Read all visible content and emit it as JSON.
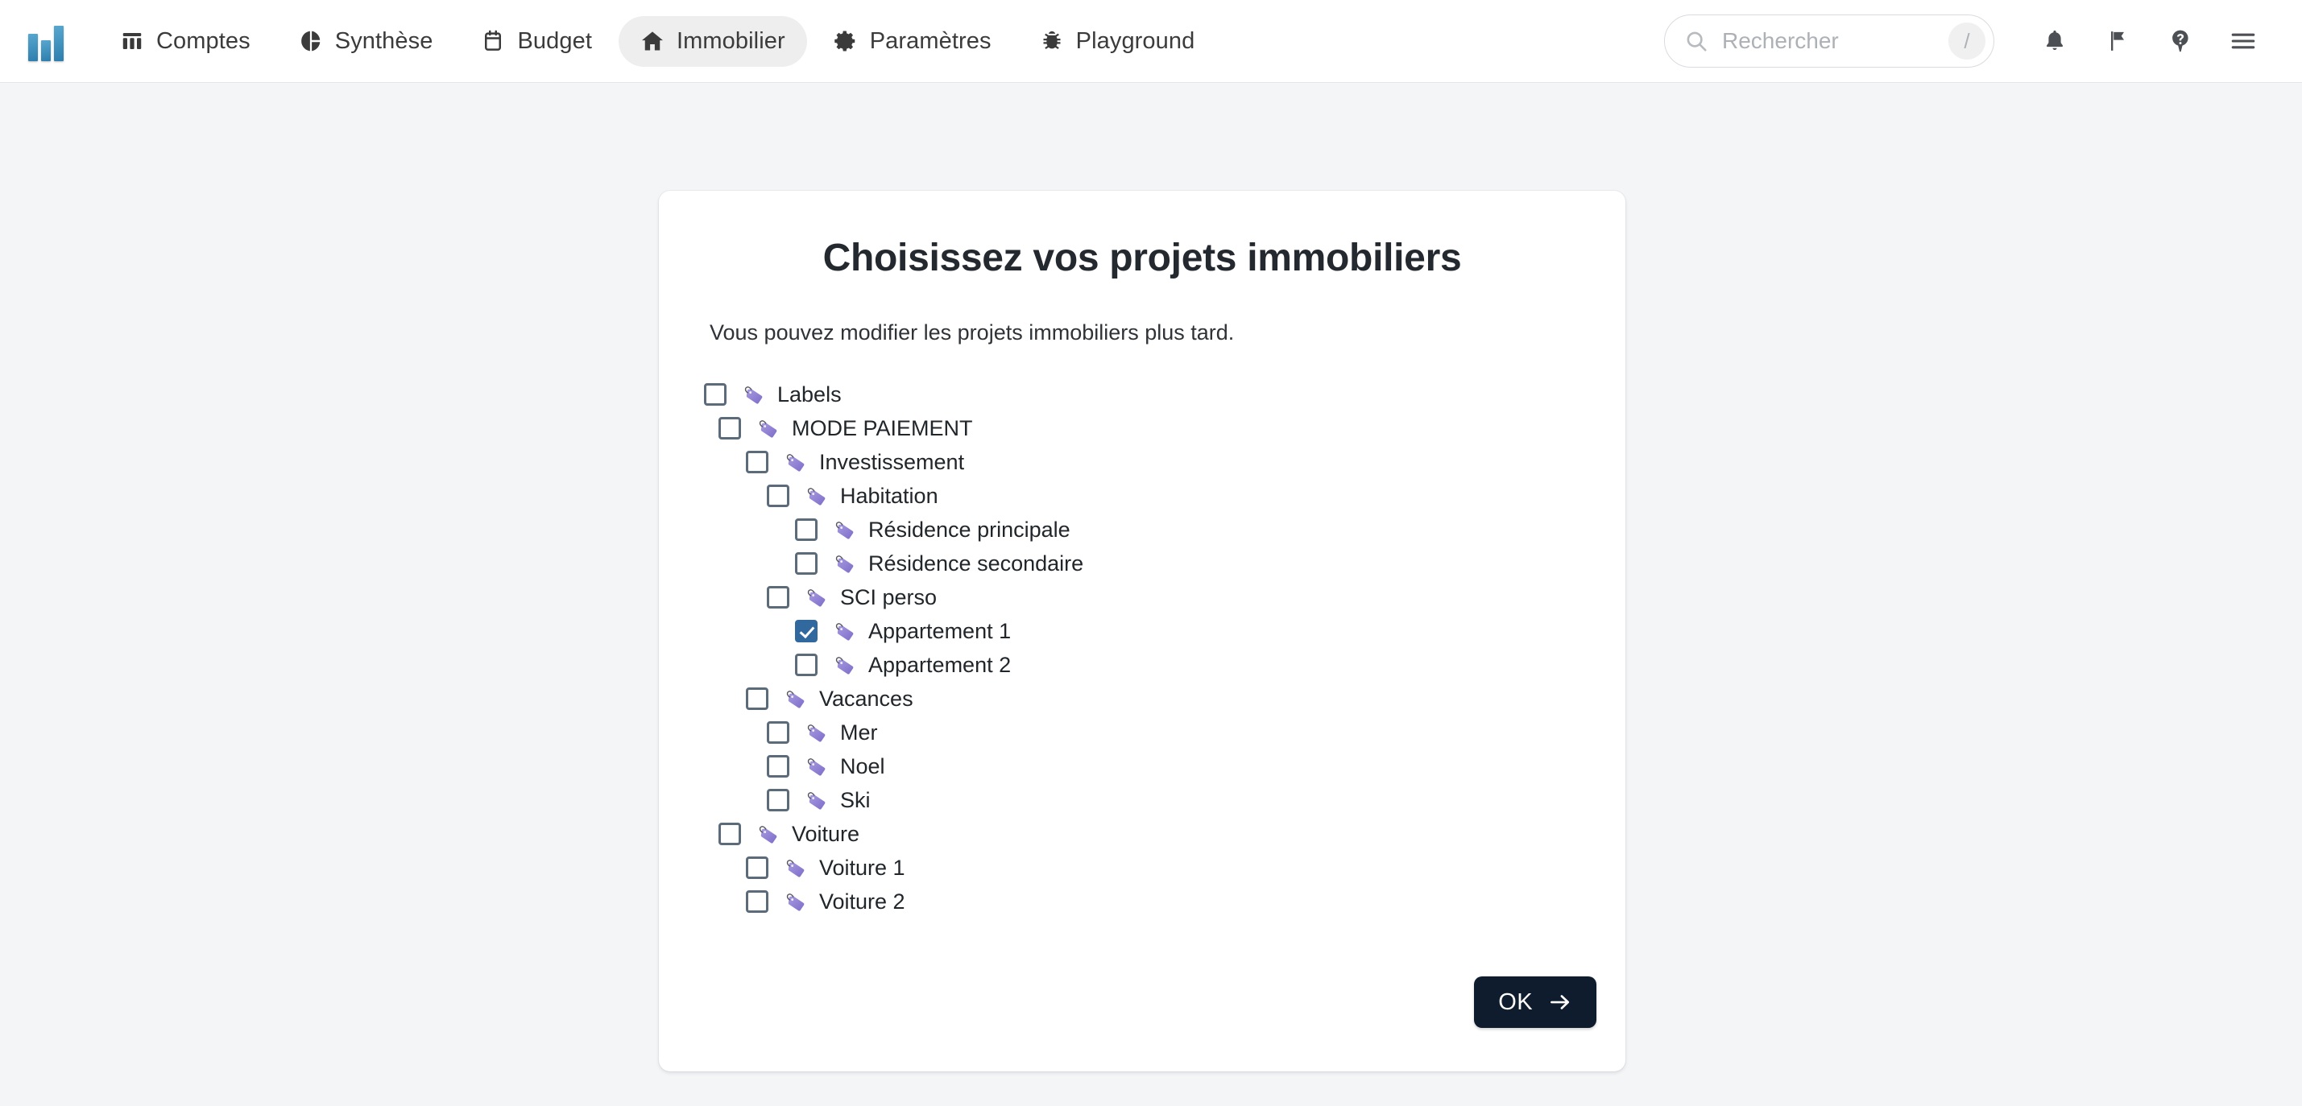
{
  "nav": {
    "logo_name": "bar-chart-logo",
    "items": [
      {
        "label": "Comptes",
        "icon": "table-columns-icon",
        "active": false
      },
      {
        "label": "Synthèse",
        "icon": "pie-chart-icon",
        "active": false
      },
      {
        "label": "Budget",
        "icon": "calendar-icon",
        "active": false
      },
      {
        "label": "Immobilier",
        "icon": "home-icon",
        "active": true
      },
      {
        "label": "Paramètres",
        "icon": "gear-icon",
        "active": false
      },
      {
        "label": "Playground",
        "icon": "bug-icon",
        "active": false
      }
    ]
  },
  "search": {
    "placeholder": "Rechercher",
    "shortcut": "/",
    "icon": "search-icon"
  },
  "top_icons": [
    {
      "name": "bell-icon",
      "label": "Notifications"
    },
    {
      "name": "flag-icon",
      "label": "Signalements"
    },
    {
      "name": "help-icon",
      "label": "Aide"
    },
    {
      "name": "hamburger-icon",
      "label": "Menu"
    }
  ],
  "card": {
    "title": "Choisissez vos projets immobiliers",
    "subtitle": "Vous pouvez modifier les projets immobiliers plus tard.",
    "ok_label": "OK"
  },
  "colors": {
    "accent_checkbox": "#31699f",
    "button_bg": "#0e1c2e",
    "page_bg": "#f4f5f7",
    "active_tab_bg": "#eeeeee",
    "tag_purple": "#8b7cd4"
  },
  "tree": [
    {
      "label": "Labels",
      "level": 0,
      "checked": false,
      "icon": "tag-icon"
    },
    {
      "label": "MODE PAIEMENT",
      "level": 1,
      "checked": false,
      "icon": "tag-icon"
    },
    {
      "label": "Investissement",
      "level": 2,
      "checked": false,
      "icon": "tag-icon"
    },
    {
      "label": "Habitation",
      "level": 3,
      "checked": false,
      "icon": "tag-icon"
    },
    {
      "label": "Résidence principale",
      "level": 4,
      "checked": false,
      "icon": "tag-icon"
    },
    {
      "label": "Résidence secondaire",
      "level": 4,
      "checked": false,
      "icon": "tag-icon"
    },
    {
      "label": "SCI perso",
      "level": 3,
      "checked": false,
      "icon": "tag-icon"
    },
    {
      "label": "Appartement 1",
      "level": 4,
      "checked": true,
      "icon": "tag-icon"
    },
    {
      "label": "Appartement 2",
      "level": 4,
      "checked": false,
      "icon": "tag-icon"
    },
    {
      "label": "Vacances",
      "level": 2,
      "checked": false,
      "icon": "tag-icon"
    },
    {
      "label": "Mer",
      "level": 3,
      "checked": false,
      "icon": "tag-icon"
    },
    {
      "label": "Noel",
      "level": 3,
      "checked": false,
      "icon": "tag-icon"
    },
    {
      "label": "Ski",
      "level": 3,
      "checked": false,
      "icon": "tag-icon"
    },
    {
      "label": "Voiture",
      "level": 1,
      "checked": false,
      "icon": "tag-icon"
    },
    {
      "label": "Voiture 1",
      "level": 2,
      "checked": false,
      "icon": "tag-icon"
    },
    {
      "label": "Voiture 2",
      "level": 2,
      "checked": false,
      "icon": "tag-icon"
    }
  ]
}
